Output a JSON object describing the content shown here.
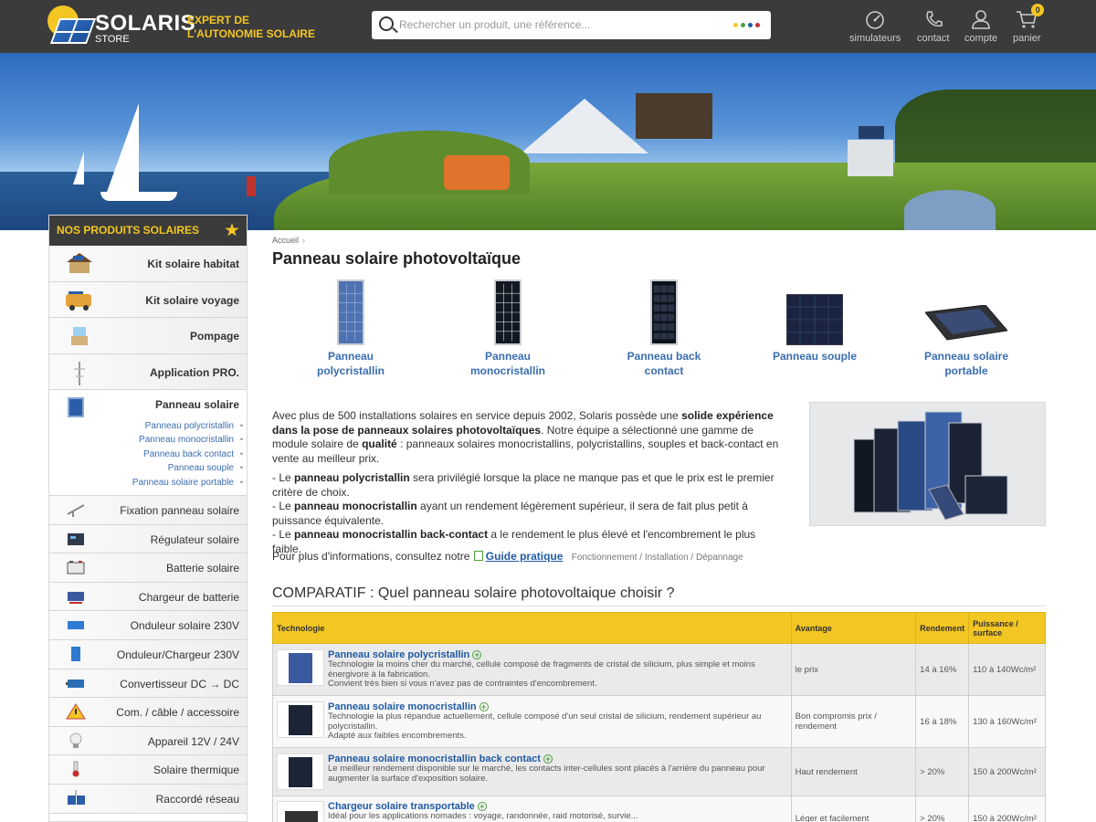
{
  "header": {
    "logo_name": "SOLARIS",
    "logo_sub": "STORE",
    "tagline_line1": "EXPERT DE",
    "tagline_line2": "L'AUTONOMIE SOLAIRE",
    "search_placeholder": "Rechercher un produit, une référence...",
    "search_dot_colors": [
      "#f3c623",
      "#4aa23a",
      "#1f5aa5",
      "#c0322b"
    ],
    "tools": [
      {
        "icon": "speedometer-icon",
        "label": "simulateurs"
      },
      {
        "icon": "phone-icon",
        "label": "contact"
      },
      {
        "icon": "user-icon",
        "label": "compte"
      },
      {
        "icon": "cart-icon",
        "label": "panier",
        "badge": "0"
      }
    ]
  },
  "sidebar": {
    "title": "NOS PRODUITS SOLAIRES",
    "main_items": [
      {
        "label": "Kit solaire habitat",
        "icon": "house-icon"
      },
      {
        "label": "Kit solaire voyage",
        "icon": "van-icon"
      },
      {
        "label": "Pompage",
        "icon": "water-tank-icon"
      },
      {
        "label": "Application PRO.",
        "icon": "antenna-icon"
      }
    ],
    "active": {
      "label": "Panneau solaire",
      "icon": "solar-panel-icon",
      "sub": [
        "Panneau polycristallin",
        "Panneau monocristallin",
        "Panneau back contact",
        "Panneau souple",
        "Panneau solaire portable"
      ]
    },
    "items": [
      {
        "label": "Fixation panneau solaire",
        "icon": "mount-icon"
      },
      {
        "label": "Régulateur solaire",
        "icon": "regulator-icon"
      },
      {
        "label": "Batterie solaire",
        "icon": "battery-icon"
      },
      {
        "label": "Chargeur de batterie",
        "icon": "charger-icon"
      },
      {
        "label": "Onduleur solaire 230V",
        "icon": "inverter-icon"
      },
      {
        "label": "Onduleur/Chargeur 230V",
        "icon": "inverter-charger-icon"
      },
      {
        "label": "Convertisseur DC → DC",
        "icon": "converter-icon"
      },
      {
        "label": "Com. / câble / accessoire",
        "icon": "warning-icon"
      },
      {
        "label": "Appareil 12V / 24V",
        "icon": "bulb-icon"
      },
      {
        "label": "Solaire thermique",
        "icon": "thermometer-icon"
      },
      {
        "label": "Raccordé réseau",
        "icon": "grid-icon"
      }
    ]
  },
  "main": {
    "breadcrumb": "Accueil",
    "breadcrumb_sep": "›",
    "title": "Panneau solaire photovoltaïque",
    "categories": [
      {
        "l1": "Panneau",
        "l2": "polycristallin"
      },
      {
        "l1": "Panneau",
        "l2": "monocristallin"
      },
      {
        "l1": "Panneau back",
        "l2": "contact"
      },
      {
        "l1": "Panneau souple",
        "l2": ""
      },
      {
        "l1": "Panneau solaire",
        "l2": "portable"
      }
    ],
    "intro": {
      "p1_a": "Avec plus de 500 installations solaires en service depuis 2002, Solaris possède une ",
      "p1_b": "solide expérience dans la pose de panneaux solaires photovoltaïques",
      "p1_c": ". Notre équipe a sélectionné une gamme de module solaire de ",
      "p1_d": "qualité",
      "p1_e": " : panneaux solaires monocristallins, polycristallins, souples et back-contact en vente au meilleur prix.",
      "b1_a": "- Le ",
      "b1_b": "panneau polycristallin",
      "b1_c": " sera privilégié lorsque la place ne manque pas et que le prix est le premier critère de choix.",
      "b2_a": "- Le ",
      "b2_b": "panneau monocristallin",
      "b2_c": " ayant un rendement légèrement supérieur, il sera de fait plus petit à puissance équivalente.",
      "b3_a": "- Le ",
      "b3_b": "panneau monocristallin back-contact",
      "b3_c": " a le rendement le plus élevé et l'encombrement le plus faible."
    },
    "more_text": "Pour plus d'informations, consultez notre",
    "guide": "Guide pratique",
    "guide_sub": "Fonctionnement / Installation / Dépannage",
    "section_title": "COMPARATIF : Quel panneau solaire photovoltaique choisir ?",
    "table": {
      "headers": [
        "Technologie",
        "Avantage",
        "Rendement",
        "Puissance / surface"
      ],
      "rows": [
        {
          "name": "Panneau solaire polycristallin",
          "desc": "Technologie la moins cher du marché, cellule composé de fragments de cristal de silicium, plus simple et moins énergivore à la fabrication.",
          "desc2": "Convient très bien si vous n'avez pas de contraintes d'encombrement.",
          "advantage": "le prix",
          "yield": "14 à 16%",
          "power": "110 à 140Wc/m²"
        },
        {
          "name": "Panneau solaire monocristallin",
          "desc": "Technologie la plus répandue actuellement, cellule composé d'un seul cristal de silicium, rendement supérieur au polycristallin.",
          "desc2": "Adapté aux faibles encombrements.",
          "advantage": "Bon compromis prix / rendement",
          "yield": "16 à 18%",
          "power": "130 à 160Wc/m²"
        },
        {
          "name": "Panneau solaire monocristallin back contact",
          "desc": "Le meilleur rendement disponible sur le marché, les contacts inter-cellules sont placés à l'arrière du panneau pour augmenter la surface d'exposition solaire.",
          "desc2": "",
          "advantage": "Haut rendement",
          "yield": "> 20%",
          "power": "150 à 200Wc/m²"
        },
        {
          "name": "Chargeur solaire transportable",
          "desc": "Idéal pour les applications nomades : voyage, randonnée, raid motorisé, survie...",
          "desc2": "",
          "advantage": "Léger et facilement",
          "yield": "> 20%",
          "power": "150 à 200Wc/m²"
        }
      ]
    }
  }
}
